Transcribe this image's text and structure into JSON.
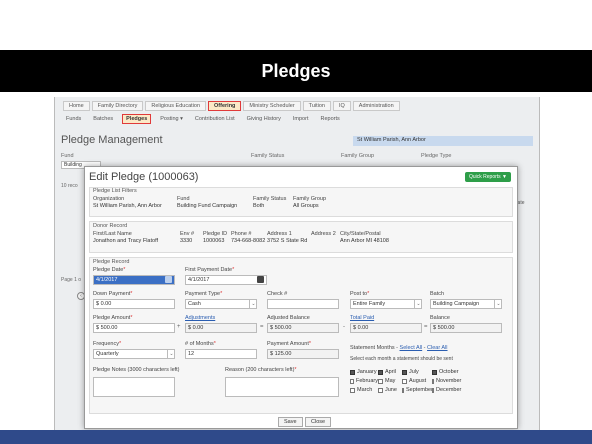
{
  "slide": {
    "title": "Pledges"
  },
  "app": {
    "nav_tabs": [
      "Home",
      "Family Directory",
      "Religious Education",
      "Offering",
      "Ministry Scheduler",
      "Tuition",
      "IQ",
      "Administration"
    ],
    "active_tab": "Offering",
    "sub_tabs": [
      "Funds",
      "Batches",
      "Pledges",
      "Posting ▾",
      "Contribution List",
      "Giving History",
      "Import",
      "Reports"
    ],
    "active_sub_tab": "Pledges",
    "page_title": "Pledge Management",
    "parish": "St William Parish, Ann Arbor",
    "filter_labels": {
      "fund": "Fund",
      "family_status": "Family Status",
      "family_group": "Family Group",
      "pledge_type": "Pledge Type"
    },
    "fund_filter_value": "Building",
    "records_label": "10 reco",
    "page_label": "Page 1 o",
    "end_date_col": "nd Date"
  },
  "modal": {
    "title": "Edit Pledge (1000063)",
    "quick_reports": "Quick Reports ▼",
    "filters": {
      "section": "Pledge List Filters",
      "organization_label": "Organization",
      "organization": "St William Parish, Ann Arbor",
      "fund_label": "Fund",
      "fund": "Building Fund Campaign",
      "family_status_label": "Family Status",
      "family_status": "Both",
      "family_group_label": "Family Group",
      "family_group": "All Groups"
    },
    "donor": {
      "section": "Donor Record",
      "name_label": "First/Last Name",
      "name": "Jonathon and Tracy Flatoff",
      "env_label": "Env #",
      "env": "3330",
      "pledge_id_label": "Pledge ID",
      "pledge_id": "1000063",
      "phone_label": "Phone #",
      "phone": "734-668-8082",
      "address1_label": "Address 1",
      "address1": "3752 S State Rd",
      "address2_label": "Address 2",
      "city_label": "City/State/Postal",
      "city": "Ann Arbor MI 48108"
    },
    "pledge": {
      "section": "Pledge Record",
      "pledge_date_label": "Pledge Date",
      "pledge_date": "4/1/2017",
      "first_payment_label": "First Payment Date",
      "first_payment": "4/1/2017",
      "down_payment_label": "Down Payment",
      "down_payment": "$ 0.00",
      "payment_type_label": "Payment Type",
      "payment_type": "Cash",
      "check_label": "Check #",
      "check": "",
      "post_to_label": "Post to",
      "post_to": "Entire Family",
      "batch_label": "Batch",
      "batch": "Building Campaign",
      "pledge_amount_label": "Pledge Amount",
      "pledge_amount": "$ 500.00",
      "adjustments_label": "Adjustments",
      "adjustments": "$ 0.00",
      "adjusted_balance_label": "Adjusted Balance",
      "adjusted_balance": "$ 500.00",
      "total_paid_label": "Total Paid",
      "total_paid": "$ 0.00",
      "balance_label": "Balance",
      "balance": "$ 500.00",
      "frequency_label": "Frequency",
      "frequency": "Quarterly",
      "months_count_label": "# of Months",
      "months_count": "12",
      "payment_amount_label": "Payment Amount",
      "payment_amount": "$ 125.00",
      "statement_months_label": "Statement Months -",
      "select_all": "Select All",
      "clear_all": "Clear All",
      "statement_help": "Select each month a statement should be sent",
      "months": [
        {
          "name": "January",
          "checked": true
        },
        {
          "name": "April",
          "checked": true
        },
        {
          "name": "July",
          "checked": true
        },
        {
          "name": "October",
          "checked": true
        },
        {
          "name": "February",
          "checked": false
        },
        {
          "name": "May",
          "checked": false
        },
        {
          "name": "August",
          "checked": false
        },
        {
          "name": "November",
          "checked": false
        },
        {
          "name": "March",
          "checked": false
        },
        {
          "name": "June",
          "checked": false
        },
        {
          "name": "September",
          "checked": false
        },
        {
          "name": "December",
          "checked": false
        }
      ],
      "notes_label": "Pledge Notes (3000 characters left)",
      "reason_label": "Reason (200 characters left)"
    },
    "save": "Save",
    "close": "Close"
  }
}
